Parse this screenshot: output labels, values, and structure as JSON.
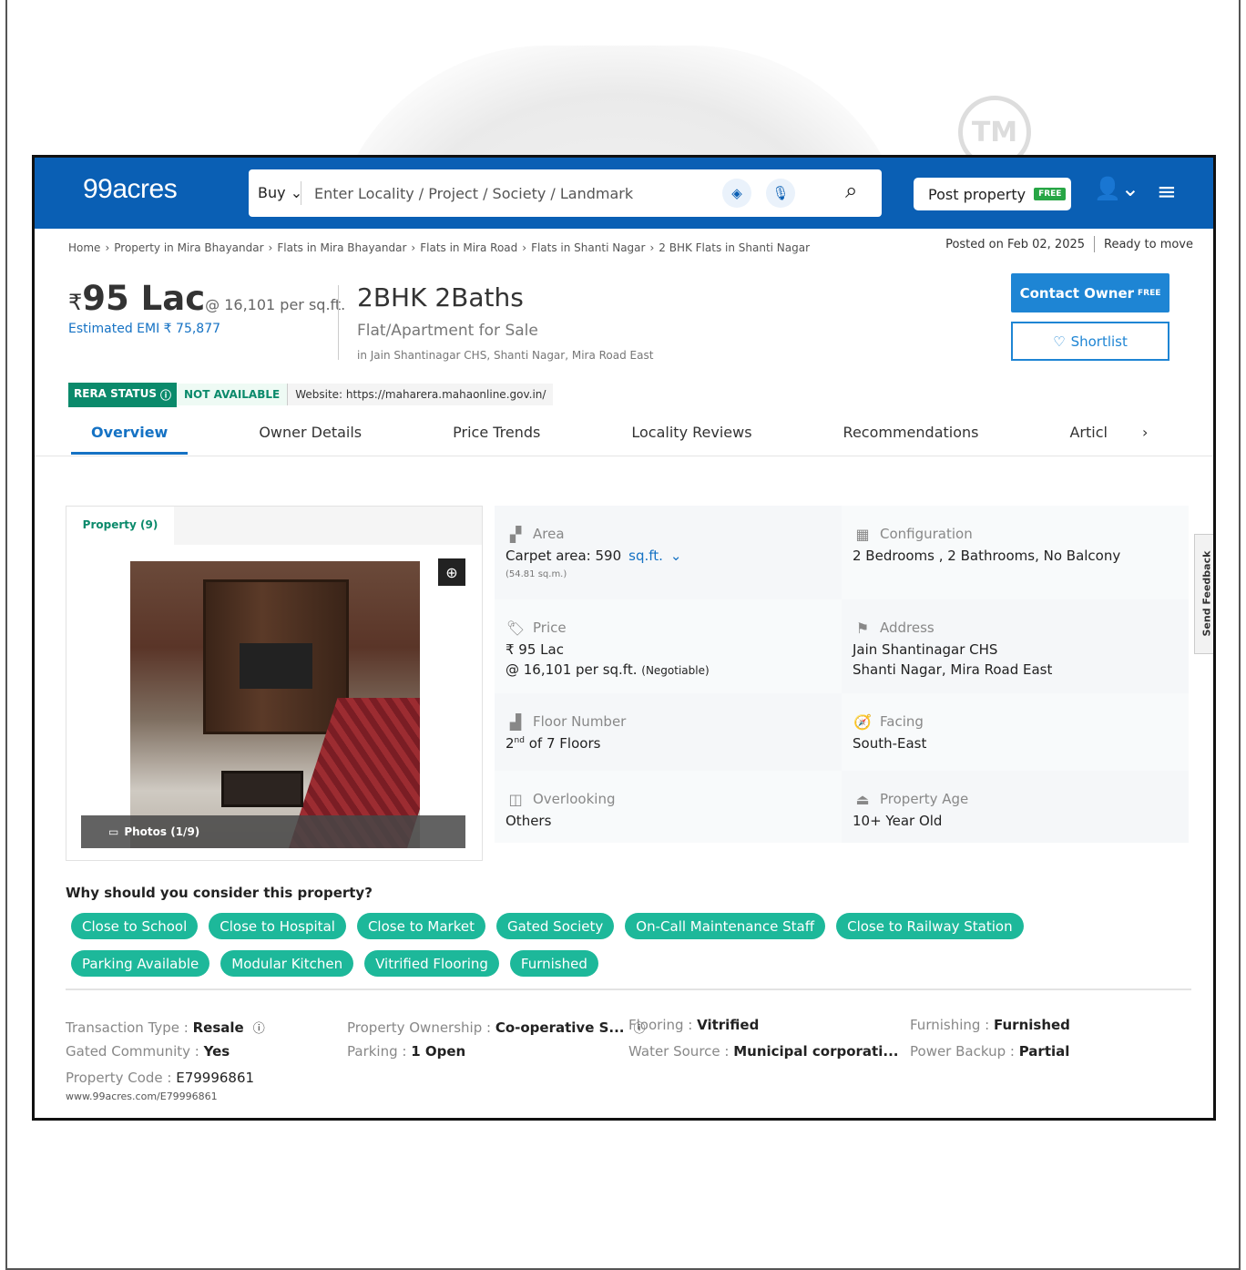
{
  "header": {
    "logo": "99acres",
    "search_mode": "Buy",
    "search_placeholder": "Enter Locality / Project / Society / Landmark",
    "post_property": "Post property",
    "post_badge": "FREE"
  },
  "breadcrumb": [
    "Home",
    "Property in Mira Bhayandar",
    "Flats in Mira Bhayandar",
    "Flats in Mira Road",
    "Flats in Shanti Nagar",
    "2 BHK Flats in Shanti Nagar"
  ],
  "posted": {
    "date": "Posted on Feb 02, 2025",
    "status": "Ready to move"
  },
  "listing": {
    "price_symbol": "₹",
    "price": "95 Lac",
    "per_sqft": "@ 16,101 per sq.ft.",
    "emi": "Estimated EMI ₹ 75,877",
    "title": "2BHK 2Baths",
    "subtitle": "Flat/Apartment for Sale",
    "location": "in Jain Shantinagar CHS, Shanti Nagar, Mira Road East"
  },
  "actions": {
    "contact": "Contact Owner",
    "contact_badge": "FREE",
    "shortlist": "Shortlist"
  },
  "rera": {
    "label": "RERA STATUS",
    "status": "NOT AVAILABLE",
    "website": "Website: https://maharera.mahaonline.gov.in/"
  },
  "tabs": [
    "Overview",
    "Owner Details",
    "Price Trends",
    "Locality Reviews",
    "Recommendations",
    "Articl"
  ],
  "gallery": {
    "tab": "Property (9)",
    "photos": "Photos (1/9)"
  },
  "details": {
    "area": {
      "label": "Area",
      "value": "Carpet area: 590",
      "unit": "sq.ft.",
      "note": "(54.81 sq.m.)"
    },
    "configuration": {
      "label": "Configuration",
      "value": "2 Bedrooms , 2 Bathrooms, No Balcony"
    },
    "price": {
      "label": "Price",
      "line1": "₹ 95 Lac",
      "line2": "@ 16,101 per sq.ft.",
      "negotiable": "(Negotiable)"
    },
    "address": {
      "label": "Address",
      "line1": "Jain Shantinagar CHS",
      "line2": "Shanti Nagar, Mira Road East"
    },
    "floor": {
      "label": "Floor Number",
      "value": "2",
      "suffix": "nd",
      "total": "of 7 Floors"
    },
    "facing": {
      "label": "Facing",
      "value": "South-East"
    },
    "overlooking": {
      "label": "Overlooking",
      "value": "Others"
    },
    "age": {
      "label": "Property Age",
      "value": "10+ Year Old"
    }
  },
  "feedback": "Send Feedback",
  "why": {
    "title": "Why should you consider this property?",
    "chips": [
      "Close to School",
      "Close to Hospital",
      "Close to Market",
      "Gated Society",
      "On-Call Maintenance Staff",
      "Close to Railway Station",
      "Parking Available",
      "Modular Kitchen",
      "Vitrified Flooring",
      "Furnished"
    ]
  },
  "facts": {
    "transaction": {
      "k": "Transaction Type : ",
      "v": "Resale"
    },
    "ownership": {
      "k": "Property Ownership : ",
      "v": "Co-operative S..."
    },
    "flooring": {
      "k": "Flooring : ",
      "v": "Vitrified"
    },
    "furnishing": {
      "k": "Furnishing : ",
      "v": "Furnished"
    },
    "gated": {
      "k": "Gated Community : ",
      "v": "Yes"
    },
    "parking": {
      "k": "Parking : ",
      "v": "1 Open"
    },
    "water": {
      "k": "Water Source : ",
      "v": "Municipal corporati..."
    },
    "power": {
      "k": "Power Backup : ",
      "v": "Partial"
    },
    "code": {
      "k": "Property Code : ",
      "v": "E79996861"
    },
    "url": "www.99acres.com/E79996861"
  },
  "watermark": {
    "tm": "TM"
  },
  "colors": {
    "brand": "#0a5fb4",
    "accent": "#1e85d4",
    "chip": "#1db89a",
    "rera": "#0b8a6b"
  }
}
